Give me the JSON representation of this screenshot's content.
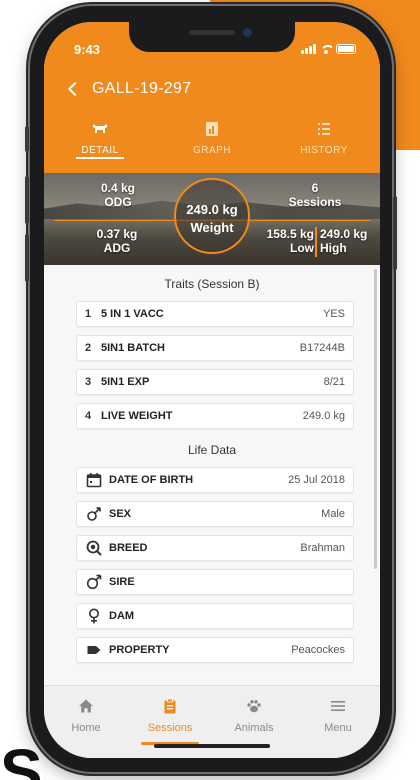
{
  "status_bar": {
    "time": "9:43"
  },
  "header": {
    "title": "GALL-19-297"
  },
  "tabs": [
    {
      "label": "DETAIL",
      "icon": "cow-icon",
      "active": true
    },
    {
      "label": "GRAPH",
      "icon": "chart-icon",
      "active": false
    },
    {
      "label": "HISTORY",
      "icon": "list-icon",
      "active": false
    }
  ],
  "summary": {
    "weight_value": "249.0 kg",
    "weight_label": "Weight",
    "odg_value": "0.4 kg",
    "odg_label": "ODG",
    "adg_value": "0.37 kg",
    "adg_label": "ADG",
    "sessions_value": "6",
    "sessions_label": "Sessions",
    "low_value": "158.5 kg",
    "low_label": "Low",
    "high_value": "249.0 kg",
    "high_label": "High"
  },
  "traits": {
    "title": "Traits (Session B)",
    "items": [
      {
        "num": "1",
        "label": "5 IN 1 VACC",
        "value": "YES"
      },
      {
        "num": "2",
        "label": "5IN1 BATCH",
        "value": "B17244B"
      },
      {
        "num": "3",
        "label": "5IN1 EXP",
        "value": "8/21"
      },
      {
        "num": "4",
        "label": "LIVE WEIGHT",
        "value": "249.0 kg"
      }
    ]
  },
  "life_data": {
    "title": "Life Data",
    "items": [
      {
        "icon": "calendar-icon",
        "label": "DATE OF BIRTH",
        "value": "25 Jul 2018"
      },
      {
        "icon": "gender-icon",
        "label": "SEX",
        "value": "Male"
      },
      {
        "icon": "breed-icon",
        "label": "BREED",
        "value": "Brahman"
      },
      {
        "icon": "male-icon",
        "label": "SIRE",
        "value": ""
      },
      {
        "icon": "female-icon",
        "label": "DAM",
        "value": ""
      },
      {
        "icon": "tag-icon",
        "label": "PROPERTY",
        "value": "Peacockes"
      }
    ]
  },
  "bottom_nav": [
    {
      "label": "Home",
      "icon": "home-icon",
      "active": false
    },
    {
      "label": "Sessions",
      "icon": "clipboard-icon",
      "active": true
    },
    {
      "label": "Animals",
      "icon": "paw-icon",
      "active": false
    },
    {
      "label": "Menu",
      "icon": "menu-icon",
      "active": false
    }
  ],
  "colors": {
    "accent": "#f08a1c",
    "inactive": "#8a8a8a"
  },
  "page_fragment": {
    "letter": "S"
  }
}
